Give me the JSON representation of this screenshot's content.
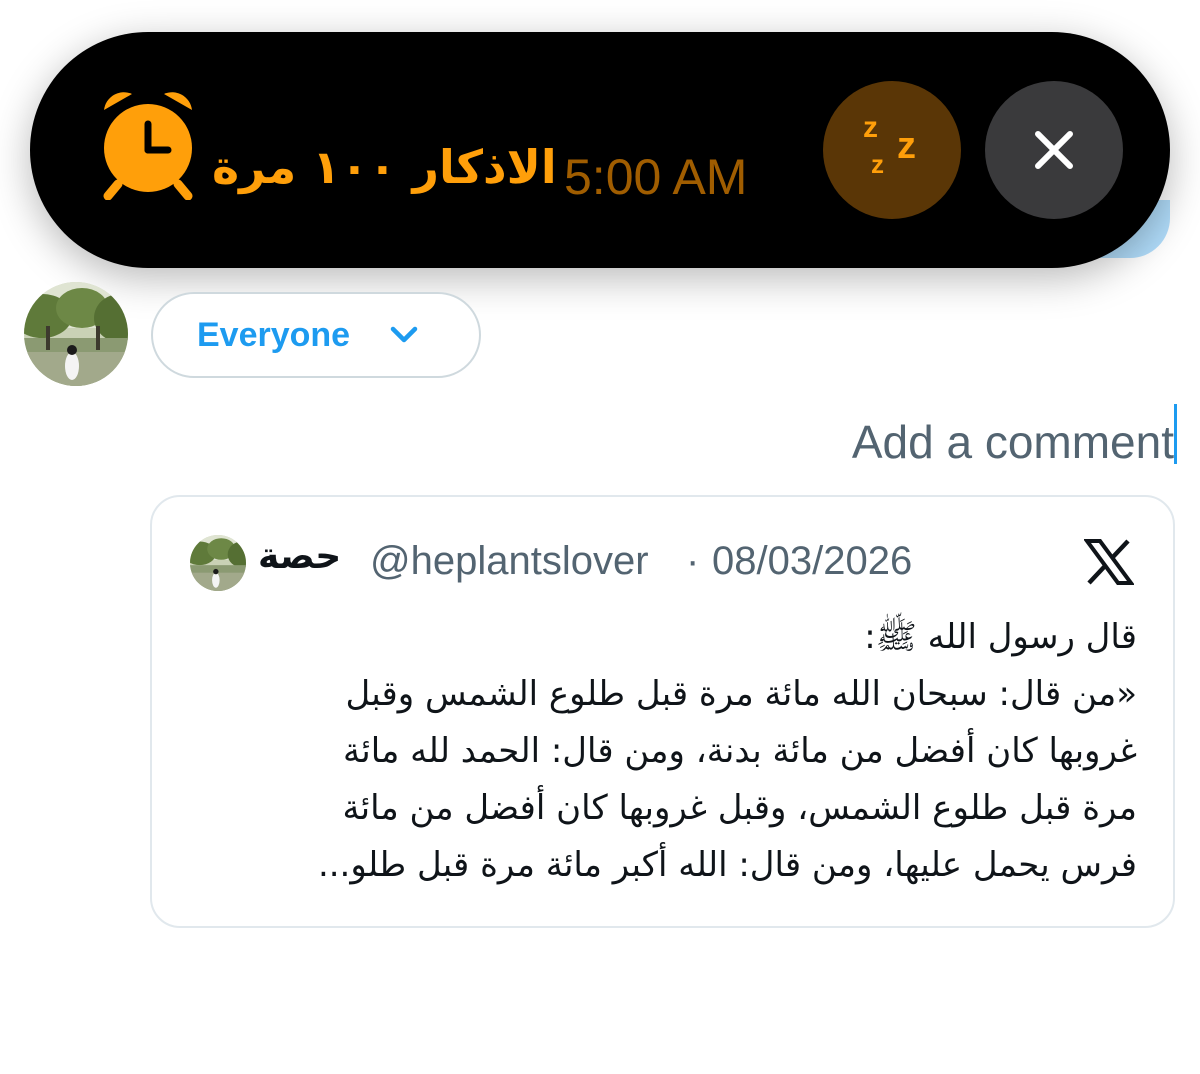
{
  "alarm": {
    "title": "الاذكار ١٠٠ مرة",
    "time": "5:00 AM",
    "icon": "alarm-clock-icon",
    "snooze_icon": "snooze-zzz-icon",
    "close_icon": "close-icon",
    "colors": {
      "background": "#000000",
      "accent": "#ff9f0a",
      "time": "#a05d00",
      "snooze_bg": "#5a3606",
      "close_bg": "#3a3a3c"
    }
  },
  "compose": {
    "audience_label": "Everyone",
    "audience_icon": "chevron-down-icon",
    "comment_placeholder": "Add a comment",
    "accent": "#1d9bf0"
  },
  "quote": {
    "author_name": "حصة",
    "handle": "@heplantslover",
    "separator": "·",
    "date": "08/03/2026",
    "platform_icon": "x-logo-icon",
    "body_lines": [
      "قال رسول الله ﷺ:",
      "«من قال: سبحان الله مائة مرة قبل طلوع الشمس وقبل",
      "غروبها كان أفضل من مائة بدنة، ومن قال: الحمد لله مائة",
      "مرة قبل طلوع الشمس، وقبل غروبها كان أفضل من مائة",
      "فرس يحمل عليها، ومن قال: الله أكبر مائة مرة قبل طلو..."
    ]
  }
}
